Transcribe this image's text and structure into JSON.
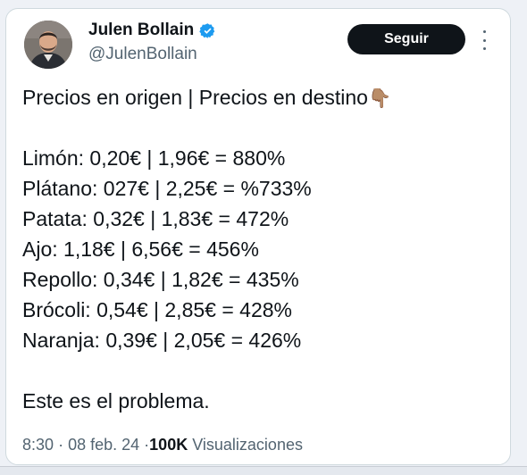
{
  "author": {
    "name": "Julen Bollain",
    "handle": "@JulenBollain"
  },
  "follow_label": "Seguir",
  "tweet": {
    "header_line": "Precios en origen | Precios en destino",
    "header_emoji": "👇🏽",
    "items": [
      "Limón: 0,20€ | 1,96€ = 880%",
      "Plátano: 027€ | 2,25€ = %733%",
      "Patata: 0,32€ | 1,83€ = 472%",
      "Ajo: 1,18€ | 6,56€ = 456%",
      "Repollo: 0,34€ | 1,82€ = 435%",
      "Brócoli: 0,54€ | 2,85€ = 428%",
      "Naranja: 0,39€ | 2,05€ = 426%"
    ],
    "closing": "Este es el problema."
  },
  "meta": {
    "time": "8:30",
    "separator": "·",
    "date": "08 feb. 24",
    "views_count": "100K",
    "views_label": "Visualizaciones"
  },
  "colors": {
    "verified": "#1d9bf0",
    "follow_bg": "#0f1419",
    "secondary_text": "#536471"
  },
  "icons": {
    "verified": "verified-badge-icon",
    "more": "more-options-icon",
    "hand": "pointing-down-hand-emoji"
  }
}
